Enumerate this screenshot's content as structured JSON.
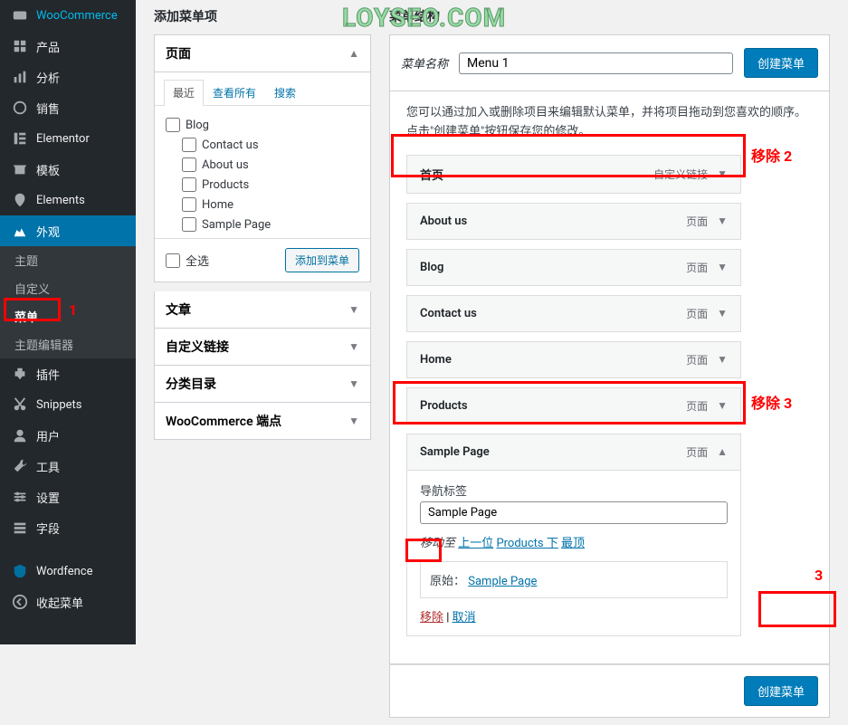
{
  "watermark": "LOYSEO.COM",
  "sidebar": {
    "items": [
      {
        "label": "WooCommerce"
      },
      {
        "label": "产品"
      },
      {
        "label": "分析"
      },
      {
        "label": "销售"
      },
      {
        "label": "Elementor"
      },
      {
        "label": "模板"
      },
      {
        "label": "Elements"
      },
      {
        "label": "外观"
      },
      {
        "label": "插件"
      },
      {
        "label": "Snippets"
      },
      {
        "label": "用户"
      },
      {
        "label": "工具"
      },
      {
        "label": "设置"
      },
      {
        "label": "字段"
      },
      {
        "label": "Wordfence"
      },
      {
        "label": "收起菜单"
      }
    ],
    "submenu": [
      {
        "label": "主题"
      },
      {
        "label": "自定义"
      },
      {
        "label": "菜单"
      },
      {
        "label": "主题编辑器"
      }
    ]
  },
  "left_col": {
    "heading": "添加菜单项",
    "pages_title": "页面",
    "tabs": [
      "最近",
      "查看所有",
      "搜索"
    ],
    "pages": [
      "Blog",
      "Contact us",
      "About us",
      "Products",
      "Home",
      "Sample Page"
    ],
    "select_all": "全选",
    "add_btn": "添加到菜单",
    "accordions": [
      "文章",
      "自定义链接",
      "分类目录",
      "WooCommerce 端点"
    ]
  },
  "right_col": {
    "heading": "菜单结构",
    "name_label": "菜单名称",
    "name_value": "Menu 1",
    "create_btn": "创建菜单",
    "help": "您可以通过加入或删除项目来编辑默认菜单，并将项目拖动到您喜欢的顺序。点击\"创建菜单\"按钮保存您的修改。",
    "items": [
      {
        "title": "首页",
        "type": "自定义链接"
      },
      {
        "title": "About us",
        "type": "页面"
      },
      {
        "title": "Blog",
        "type": "页面"
      },
      {
        "title": "Contact us",
        "type": "页面"
      },
      {
        "title": "Home",
        "type": "页面"
      },
      {
        "title": "Products",
        "type": "页面"
      },
      {
        "title": "Sample Page",
        "type": "页面"
      }
    ],
    "expanded": {
      "nav_label": "导航标签",
      "nav_value": "Sample Page",
      "move_label": "移动至",
      "move_up": "上一位",
      "move_under": "Products 下",
      "move_top": "最顶",
      "original_label": "原始：",
      "original_link": "Sample Page",
      "remove": "移除",
      "sep": " | ",
      "cancel": "取消"
    },
    "bottom_btn": "创建菜单"
  },
  "annotations": {
    "a1": "1",
    "a2": "移除 2",
    "a3": "移除 3",
    "a3b": "3"
  }
}
